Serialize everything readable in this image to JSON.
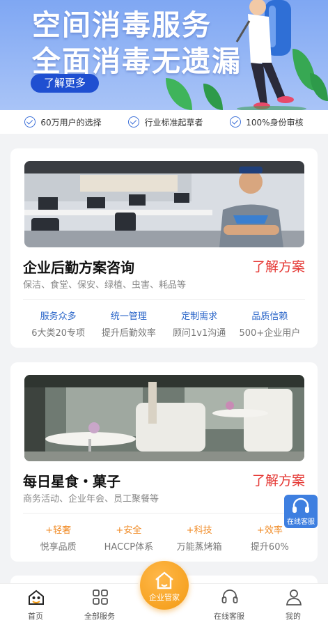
{
  "banner": {
    "line1": "空间消毒服务",
    "line2": "全面消毒无遗漏",
    "button": "了解更多"
  },
  "trust": [
    {
      "icon": "check-circle-icon",
      "label": "60万用户的选择"
    },
    {
      "icon": "check-circle-icon",
      "label": "行业标准起草者"
    },
    {
      "icon": "check-circle-icon",
      "label": "100%身份审核"
    }
  ],
  "cards": [
    {
      "title": "企业后勤方案咨询",
      "link": "了解方案",
      "subtitle": "保洁、食堂、保安、绿植、虫害、耗品等",
      "features": [
        {
          "title": "服务众多",
          "desc": "6大类20专项"
        },
        {
          "title": "统一管理",
          "desc": "提升后勤效率"
        },
        {
          "title": "定制需求",
          "desc": "顾问1v1沟通"
        },
        {
          "title": "品质信赖",
          "desc": "500+企业用户"
        }
      ]
    },
    {
      "title": "每日星食・菓子",
      "link": "了解方案",
      "subtitle": "商务活动、企业年会、员工聚餐等",
      "features": [
        {
          "title": "+轻奢",
          "desc": "悦享品质"
        },
        {
          "title": "+安全",
          "desc": "HACCP体系"
        },
        {
          "title": "+科技",
          "desc": "万能蒸烤箱"
        },
        {
          "title": "+效率",
          "desc": "提升60%"
        }
      ]
    }
  ],
  "float_service": {
    "label": "在线客服",
    "icon": "headset-icon"
  },
  "tabbar": {
    "home": "首页",
    "services": "全部服务",
    "center": "企业管家",
    "support": "在线客服",
    "mine": "我的"
  },
  "colors": {
    "accent_blue": "#2b66c9",
    "accent_orange": "#f08a24",
    "link_red": "#e53935",
    "center_orange": "#f39a12"
  }
}
